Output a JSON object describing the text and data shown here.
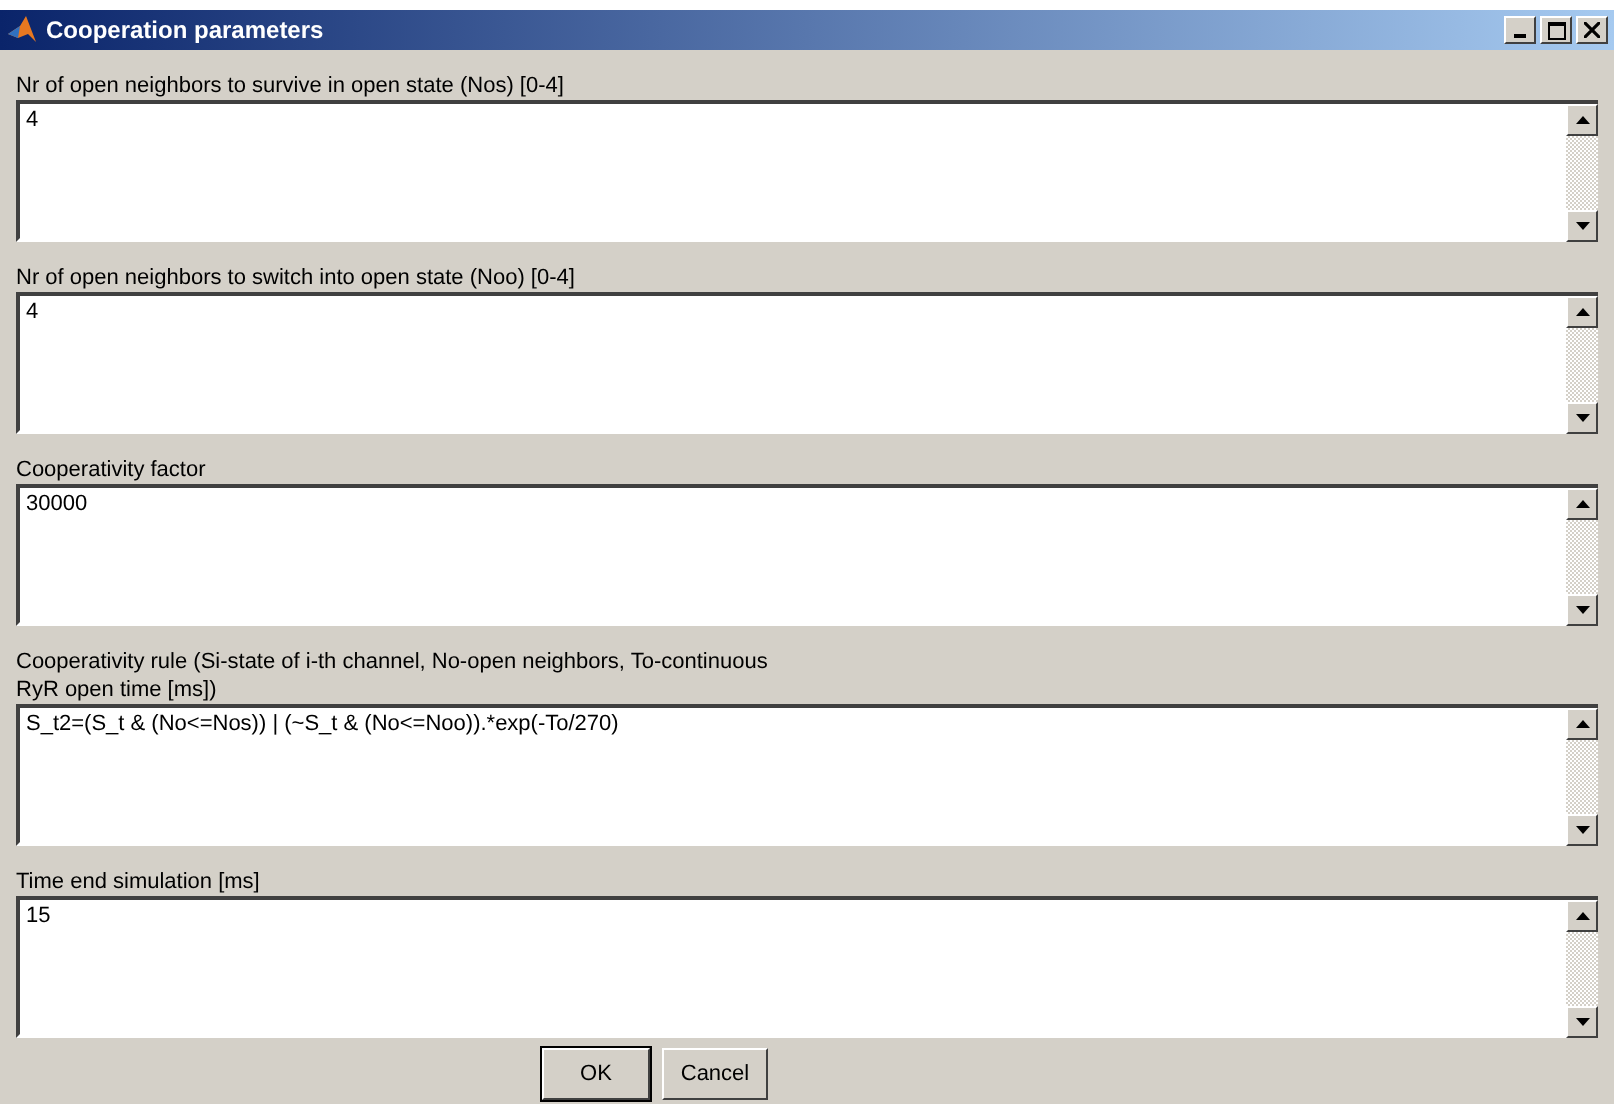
{
  "window": {
    "title": "Cooperation parameters"
  },
  "fields": [
    {
      "label": "Nr of open neighbors to survive in open state (Nos) [0-4]",
      "value": "4"
    },
    {
      "label": "Nr of open neighbors to switch into open state (Noo) [0-4]",
      "value": "4"
    },
    {
      "label": "Cooperativity factor",
      "value": "30000"
    },
    {
      "label": "Cooperativity rule (Si-state of i-th channel, No-open neighbors, To-continuous\nRyR open time [ms])",
      "value": "S_t2=(S_t & (No<=Nos)) | (~S_t & (No<=Noo)).*exp(-To/270)"
    },
    {
      "label": "Time end simulation [ms]",
      "value": "15"
    }
  ],
  "buttons": [
    {
      "label": "OK",
      "kind": "default"
    },
    {
      "label": "Cancel",
      "kind": "normal"
    }
  ]
}
